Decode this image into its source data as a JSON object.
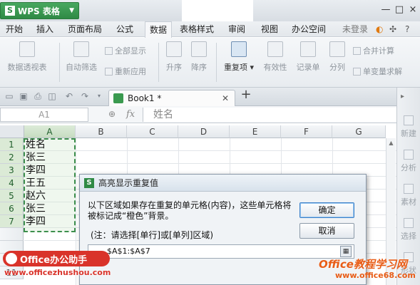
{
  "app": {
    "name": "WPS 表格",
    "logo": "S"
  },
  "window_controls": [
    "—",
    "□",
    "×"
  ],
  "menu": {
    "items": [
      "开始",
      "插入",
      "页面布局",
      "公式",
      "数据",
      "表格样式",
      "审阅",
      "视图",
      "办公空间"
    ],
    "active": "数据",
    "login": "未登录",
    "help": "?"
  },
  "ribbon": {
    "pivot": "数据透视表",
    "autofilter": "自动筛选",
    "show_all": "全部显示",
    "reapply": "重新应用",
    "sort_asc": "升序",
    "sort_desc": "降序",
    "duplicates": "重复项",
    "validity": "有效性",
    "record_sheet": "记录单",
    "split": "分列",
    "consolidate": "合并计算",
    "what_if": "单变量求解"
  },
  "tabs": {
    "doc": "Book1 *",
    "add": "+"
  },
  "formula_bar": {
    "cell_ref": "A1",
    "fx": "fx",
    "content": "姓名"
  },
  "sheet": {
    "columns": [
      "A",
      "B",
      "C",
      "D",
      "E",
      "F",
      "G"
    ],
    "rows": [
      "1",
      "2",
      "3",
      "4",
      "5",
      "6",
      "7",
      "",
      "",
      "10",
      "11"
    ],
    "column_a": [
      "姓名",
      "张三",
      "李四",
      "王五",
      "赵六",
      "张三",
      "李四"
    ]
  },
  "sidebar": [
    "新建",
    "分析",
    "素材",
    "选择",
    "形状"
  ],
  "dialog": {
    "title": "高亮显示重复值",
    "message": "以下区域如果存在重复的单元格(内容)，这些单元格将被标记成“橙色”背景。",
    "note": "(注：请选择[单行]或[单列]区域)",
    "range": "$A$1:$A$7",
    "ok": "确定",
    "cancel": "取消"
  },
  "watermarks": {
    "brand": "Office办公助手",
    "brand_url": "www.officezhushou.com",
    "site": "Office教程学习网",
    "site_url": "www.office68.com"
  },
  "colors": {
    "accent": "#2f8a45",
    "watermark_red": "#d9332a",
    "watermark_orange": "#e85c16"
  }
}
